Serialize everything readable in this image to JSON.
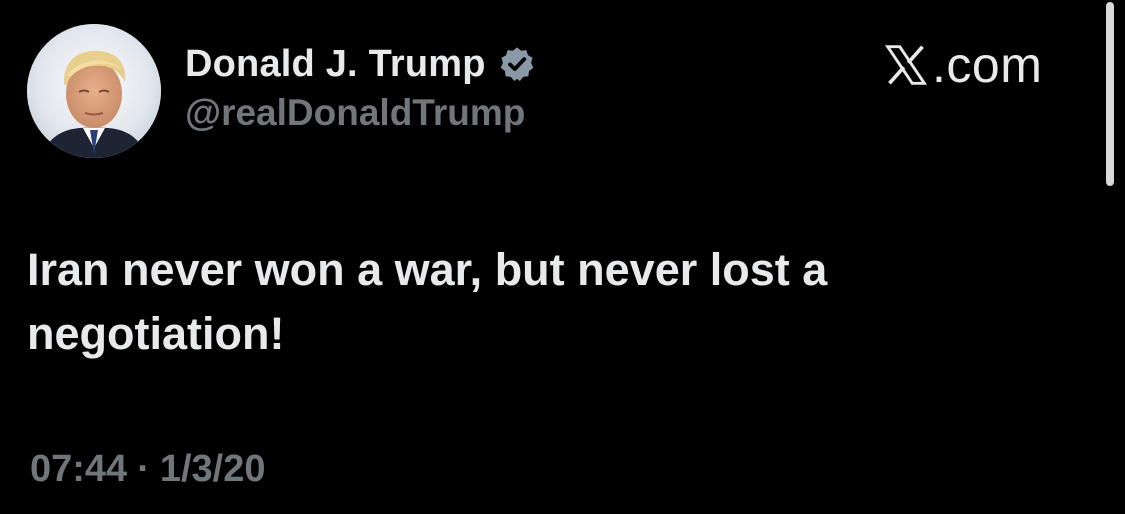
{
  "author": {
    "name": "Donald J. Trump",
    "handle": "@realDonaldTrump",
    "verified": true,
    "verified_color": "#8a99a8",
    "avatar_icon": "profile-photo"
  },
  "brand": {
    "text": ".com",
    "icon": "x-logo-icon"
  },
  "tweet": {
    "text": "Iran never won a war, but never lost a\nnegotiation!"
  },
  "meta": {
    "time": "07:44",
    "separator": "·",
    "date": "1/3/20"
  },
  "colors": {
    "background": "#000000",
    "primary_text": "#e7e9ea",
    "secondary_text": "#71767b"
  }
}
